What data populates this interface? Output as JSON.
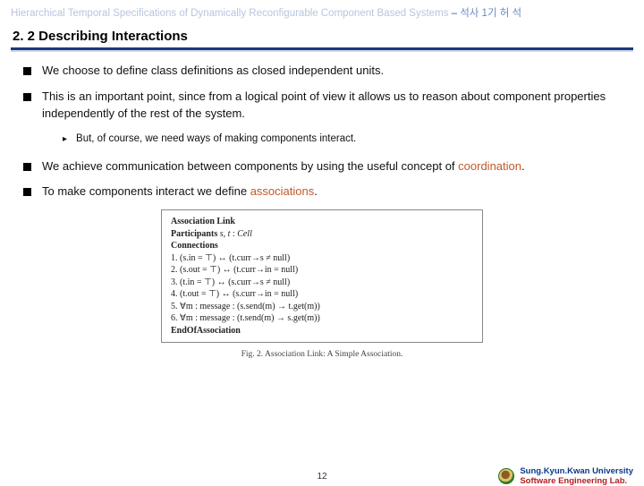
{
  "header": {
    "title_faded": "Hierarchical Temporal Specifications of Dynamically Reconfigurable Component Based Systems",
    "separator": " – ",
    "title_suffix": "석사 1기 허 석"
  },
  "section_title": "2. 2 Describing Interactions",
  "bullets": {
    "b1": "We choose to define class definitions as closed independent units.",
    "b2": "This is an important point, since from a logical point of view it allows us to reason about component properties independently of the rest of the system.",
    "sub1": "But, of course, we need ways of making components interact.",
    "b3_pre": "We achieve communication between components by using the useful concept of ",
    "b3_hl": "coordination",
    "b3_post": ".",
    "b4_pre": "To make components interact we define ",
    "b4_hl": "associations",
    "b4_post": "."
  },
  "figure": {
    "l1": "Association Link",
    "l2": "Participants s, t : Cell",
    "l3": "Connections",
    "l4": "1.  (s.in = ⊤) ↔ (t.curr→s ≠ null)",
    "l5": "2.  (s.out = ⊤) ↔ (t.curr→in = null)",
    "l6": "3.  (t.in = ⊤) ↔ (s.curr→s ≠ null)",
    "l7": "4.  (t.out = ⊤) ↔ (s.curr→in = null)",
    "l8": "5.  ∀m : message : (s.send(m) → t.get(m))",
    "l9": "6.  ∀m : message : (t.send(m) → s.get(m))",
    "l10": "EndOfAssociation",
    "caption": "Fig. 2. Association Link: A Simple Association."
  },
  "footer": {
    "page": "12",
    "uni": "Sung.Kyun.Kwan University",
    "lab": "Software Engineering Lab."
  }
}
